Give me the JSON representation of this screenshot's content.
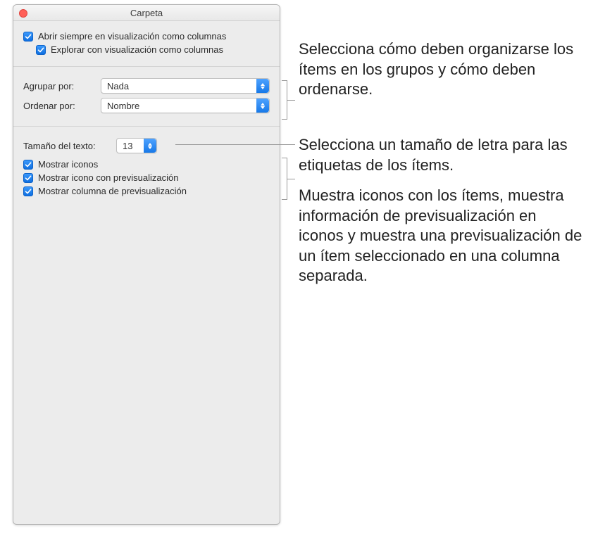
{
  "window": {
    "title": "Carpeta"
  },
  "section1": {
    "always_open_columns": "Abrir siempre en visualización como columnas",
    "browse_columns": "Explorar con visualización como columnas"
  },
  "section2": {
    "group_by_label": "Agrupar por:",
    "group_by_value": "Nada",
    "sort_by_label": "Ordenar por:",
    "sort_by_value": "Nombre"
  },
  "section3": {
    "text_size_label": "Tamaño del texto:",
    "text_size_value": "13",
    "show_icons": "Mostrar iconos",
    "show_icon_preview": "Mostrar icono con previsualización",
    "show_preview_column": "Mostrar columna de previsualización"
  },
  "callouts": {
    "c1": "Selecciona cómo deben organizarse los ítems en los grupos y cómo deben ordenarse.",
    "c2": "Selecciona un tamaño de letra para las etiquetas de los ítems.",
    "c3": "Muestra iconos con los ítems, muestra información de previsualización en iconos y muestra una previsualización de un ítem seleccionado en una columna separada."
  }
}
